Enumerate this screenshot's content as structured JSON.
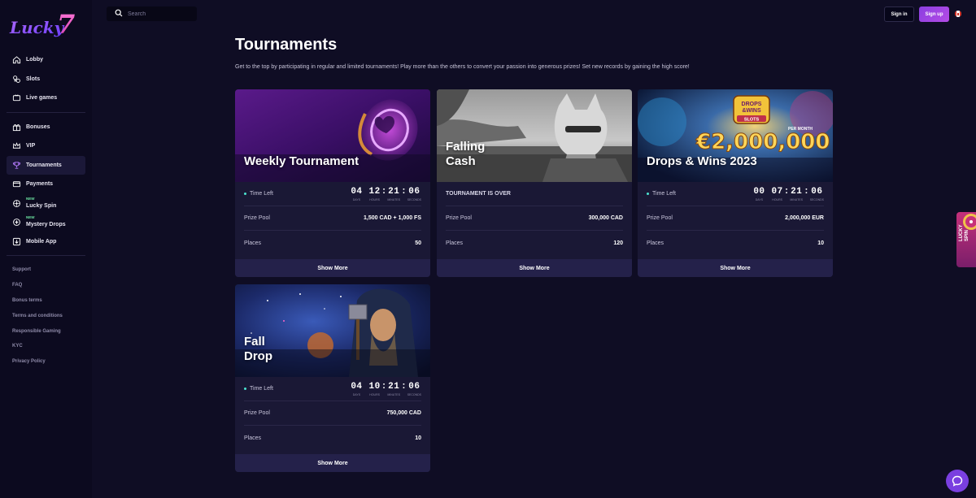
{
  "brand": {
    "logo_text": "Lucky 7"
  },
  "sidebar": {
    "nav_primary": [
      {
        "label": "Lobby",
        "icon": "home-icon"
      },
      {
        "label": "Slots",
        "icon": "slots-icon"
      },
      {
        "label": "Live games",
        "icon": "live-games-icon"
      }
    ],
    "nav_secondary": [
      {
        "label": "Bonuses",
        "icon": "gift-icon"
      },
      {
        "label": "VIP",
        "icon": "crown-icon"
      },
      {
        "label": "Tournaments",
        "icon": "trophy-icon",
        "active": true
      },
      {
        "label": "Payments",
        "icon": "card-icon"
      },
      {
        "label": "Lucky Spin",
        "icon": "wheel-icon",
        "badge": "NEW"
      },
      {
        "label": "Mystery Drops",
        "icon": "drops-icon",
        "badge": "NEW"
      },
      {
        "label": "Mobile App",
        "icon": "download-icon"
      }
    ],
    "links": [
      "Support",
      "FAQ",
      "Bonus terms",
      "Terms and conditions",
      "Responsible Gaming",
      "KYC",
      "Privacy Policy"
    ]
  },
  "header": {
    "search_placeholder": "Search",
    "signin_label": "Sign in",
    "signup_label": "Sign up"
  },
  "page": {
    "title": "Tournaments",
    "intro": "Get to the top by participating in regular and limited tournaments! Play more than the others to convert your passion into generous prizes! Set new records by gaining the high score!"
  },
  "labels": {
    "time_left": "Time Left",
    "prize_pool": "Prize Pool",
    "places": "Places",
    "show_more": "Show More",
    "over": "TOURNAMENT IS OVER",
    "days": "DAYS",
    "hours": "HOURS",
    "minutes": "MINUTES",
    "seconds": "SECONDS"
  },
  "tournaments": [
    {
      "title": "Weekly Tournament",
      "days": "04",
      "hours": "12",
      "minutes": "21",
      "seconds": "06",
      "prize": "1,500 CAD + 1,000 FS",
      "places": "50"
    },
    {
      "title_line1": "Falling",
      "title_line2": "Cash",
      "prize": "300,000 CAD",
      "places": "120"
    },
    {
      "title": "Drops & Wins 2023",
      "days": "00",
      "hours": "07",
      "minutes": "21",
      "seconds": "06",
      "prize": "2,000,000 EUR",
      "places": "10",
      "banner_logo_line1": "DROPS",
      "banner_logo_line2": "&WINS",
      "banner_logo_sub": "SLOTS",
      "banner_amount": "€2,000,000",
      "banner_per": "PER MONTH"
    },
    {
      "title_line1": "Fall",
      "title_line2": "Drop",
      "days": "04",
      "hours": "10",
      "minutes": "21",
      "seconds": "06",
      "prize": "750,000 CAD",
      "places": "10"
    }
  ],
  "side_promo": {
    "line1": "LUCKY",
    "line2": "SPIN"
  }
}
